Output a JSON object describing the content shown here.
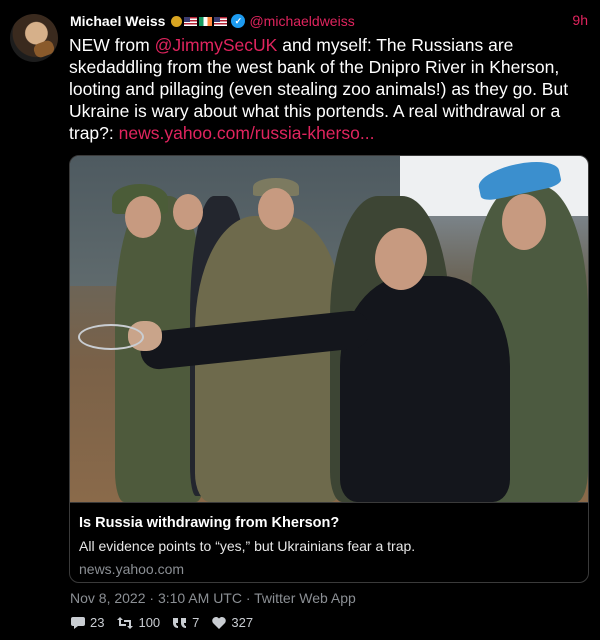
{
  "tweet": {
    "author": {
      "name": "Michael Weiss",
      "handle": "@michaeldweiss",
      "verified": true,
      "name_emojis": [
        "sun-badge-icon",
        "us-flag-icon",
        "ireland-flag-icon",
        "us-flag-icon"
      ]
    },
    "time_ago": "9h",
    "text": {
      "part1": "NEW from ",
      "mention": "@JimmySecUK",
      "part2": " and myself: The Russians are skedaddling from the west bank of the Dnipro River in Kherson, looting and pillaging (even stealing zoo animals!) as they go. But Ukraine is wary about what this portends. A real withdrawal or a trap?: ",
      "link": "news.yahoo.com/russia-kherso..."
    },
    "card": {
      "title": "Is Russia withdrawing from Kherson?",
      "description": "All evidence points to “yes,” but Ukrainians fear a trap.",
      "domain": "news.yahoo.com"
    },
    "meta": "Nov 8, 2022 · 3:10 AM UTC · Twitter Web App",
    "stats": {
      "replies": "23",
      "retweets": "100",
      "quotes": "7",
      "likes": "327"
    }
  },
  "colors": {
    "background": "#000000",
    "accent": "#e0245e",
    "muted": "#8b8f94",
    "verified": "#1d9bf0"
  }
}
